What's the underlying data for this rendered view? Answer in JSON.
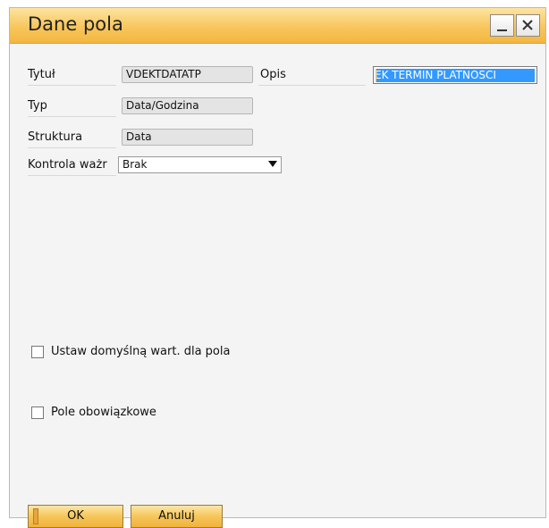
{
  "window": {
    "title": "Dane pola",
    "accent": "#f6c65a"
  },
  "form": {
    "tytul_label": "Tytuł",
    "tytul_value": "VDEKTDATATP",
    "opis_label": "Opis",
    "opis_value": "EK TERMIN PLATNOSCI",
    "typ_label": "Typ",
    "typ_value": "Data/Godzina",
    "struktura_label": "Struktura",
    "struktura_value": "Data",
    "kontrola_label": "Kontrola ważr",
    "kontrola_value": "Brak"
  },
  "options": {
    "default_value_label": "Ustaw domyślną wart. dla pola",
    "default_value_checked": false,
    "required_label": "Pole obowiązkowe",
    "required_checked": false
  },
  "buttons": {
    "ok_label": "OK",
    "cancel_label": "Anuluj"
  }
}
